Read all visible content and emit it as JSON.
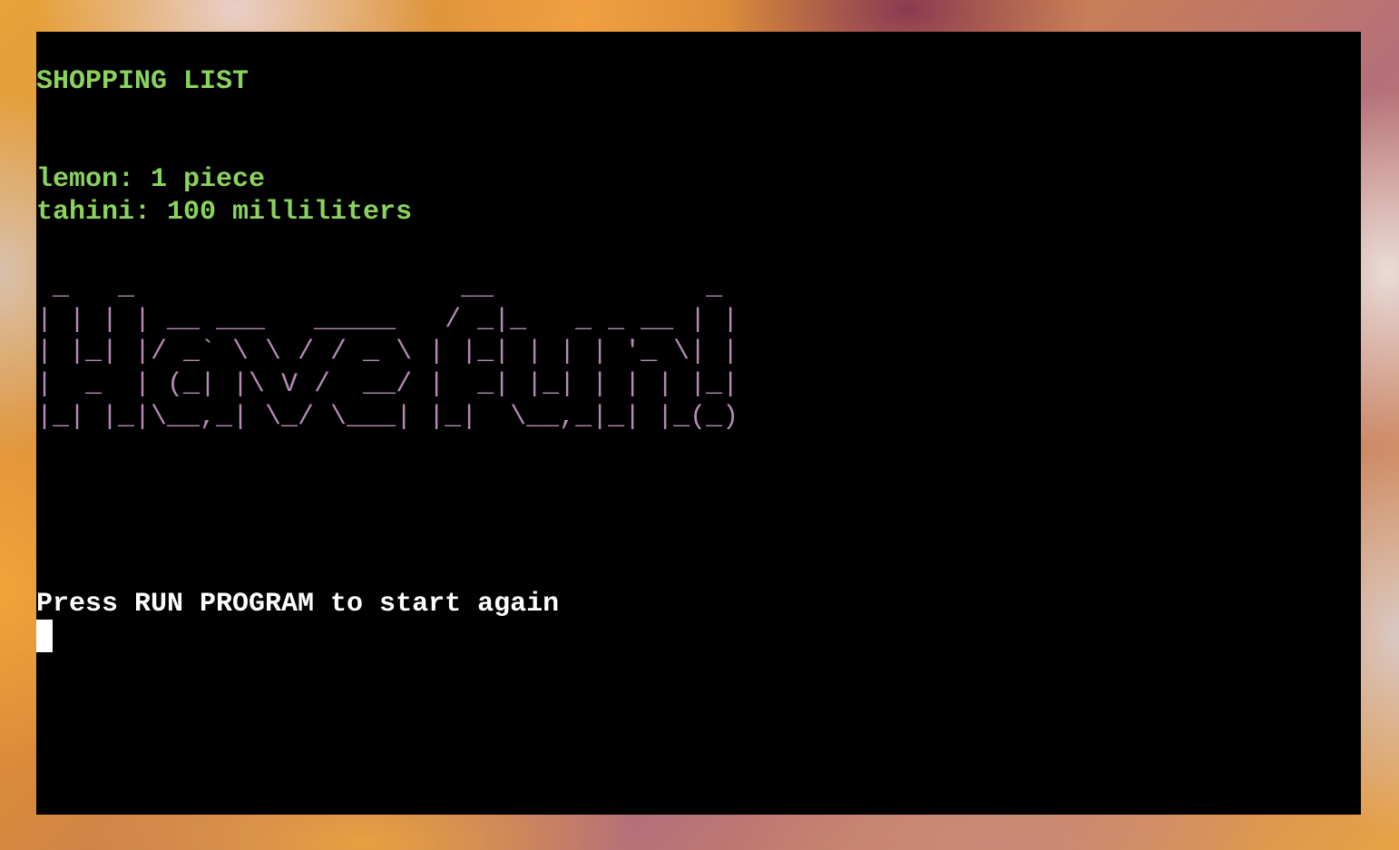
{
  "terminal": {
    "title": "SHOPPING LIST",
    "items": [
      {
        "name": "lemon",
        "quantity": "1",
        "unit": "piece",
        "text": "lemon: 1 piece"
      },
      {
        "name": "tahini",
        "quantity": "100",
        "unit": "milliliters",
        "text": "tahini: 100 milliliters"
      }
    ],
    "ascii_art_text": "Have fun!",
    "ascii_art": " _   _                    __             _ \n| | | | __ ___   _____   / _|_   _ _ __ | |\n| |_| |/ _` \\ \\ / / _ \\ | |_| | | | '_ \\| |\n|  _  | (_| |\\ V /  __/ |  _| |_| | | | |_|\n|_| |_|\\__,_| \\_/ \\___| |_|  \\__,_|_| |_(_)",
    "prompt_message": "Press RUN PROGRAM to start again",
    "colors": {
      "text_primary": "#8ad35e",
      "ascii_art": "#b58ab5",
      "prompt": "#ffffff",
      "background": "#000000"
    }
  }
}
